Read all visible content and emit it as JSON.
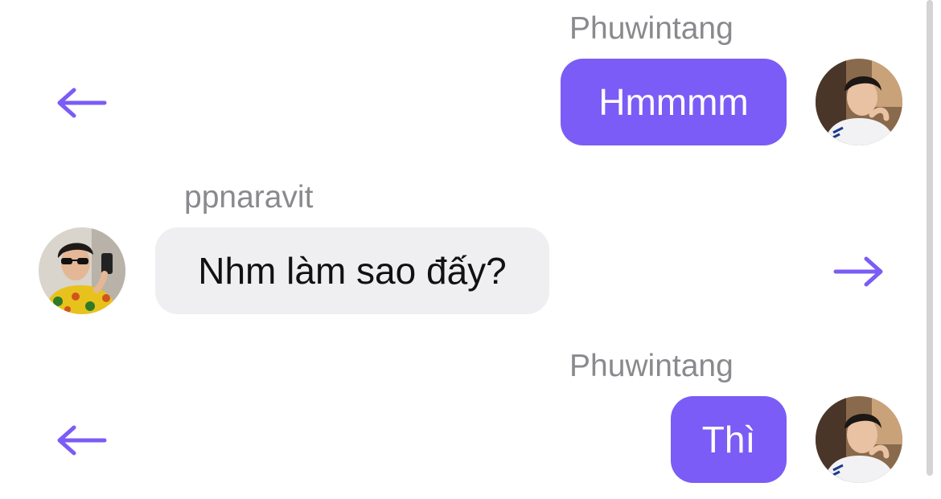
{
  "messages": [
    {
      "sender": "Phuwintang",
      "text": "Hmmmm",
      "direction": "outgoing",
      "avatar_icon": "avatar-man-white-shirt"
    },
    {
      "sender": "ppnaravit",
      "text": "Nhm làm sao đấy?",
      "direction": "incoming",
      "avatar_icon": "avatar-man-sunglasses-floral-shirt"
    },
    {
      "sender": "Phuwintang",
      "text": "Thì",
      "direction": "outgoing",
      "avatar_icon": "avatar-man-white-shirt"
    }
  ],
  "icons": {
    "reply_left": "arrow-left-icon",
    "reply_right": "arrow-right-icon"
  },
  "colors": {
    "accent": "#7B5CF6",
    "incoming_bubble": "#EFEFF1",
    "sender_name": "#8A8A8E"
  }
}
